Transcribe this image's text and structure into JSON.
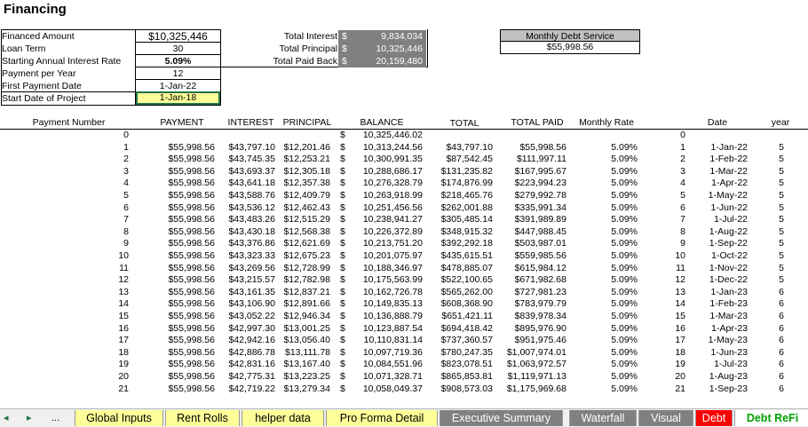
{
  "title": "Financing",
  "inputs": [
    {
      "label": "Financed Amount",
      "value": "$10,325,446"
    },
    {
      "label": "Loan Term",
      "value": "30"
    },
    {
      "label": "Starting Annual Interest Rate",
      "value": "5.09%"
    },
    {
      "label": "Payment per Year",
      "value": "12"
    },
    {
      "label": "First Payment Date",
      "value": "1-Jan-22"
    },
    {
      "label": "Start Date of Project",
      "value": "1-Jan-18"
    }
  ],
  "summary": [
    {
      "label": "Total Interest",
      "currency": "$",
      "value": "9,834,034"
    },
    {
      "label": "Total Principal",
      "currency": "$",
      "value": "10,325,446"
    },
    {
      "label": "Total Paid Back",
      "currency": "$",
      "value": "20,159,480"
    }
  ],
  "debt_service": {
    "label": "Monthly Debt Service",
    "value": "$55,998.56"
  },
  "columns": {
    "payment_number": "Payment Number",
    "payment": "PAYMENT",
    "interest": "INTEREST",
    "principal": "PRINCIPAL",
    "balance": "BALANCE",
    "total": "TOTAL",
    "total_paid": "TOTAL PAID",
    "monthly_rate": "Monthly Rate",
    "date": "Date",
    "year": "year"
  },
  "rows": [
    {
      "n": "0",
      "pay": "",
      "int": "",
      "prin": "",
      "cur": "$",
      "bal": "10,325,446.02",
      "tot": "",
      "paid": "",
      "rate": "",
      "idx": "0",
      "date": "",
      "yr": ""
    },
    {
      "n": "1",
      "pay": "$55,998.56",
      "int": "$43,797.10",
      "prin": "$12,201.46",
      "cur": "$",
      "bal": "10,313,244.56",
      "tot": "$43,797.10",
      "paid": "$55,998.56",
      "rate": "5.09%",
      "idx": "1",
      "date": "1-Jan-22",
      "yr": "5"
    },
    {
      "n": "2",
      "pay": "$55,998.56",
      "int": "$43,745.35",
      "prin": "$12,253.21",
      "cur": "$",
      "bal": "10,300,991.35",
      "tot": "$87,542.45",
      "paid": "$111,997.11",
      "rate": "5.09%",
      "idx": "2",
      "date": "1-Feb-22",
      "yr": "5"
    },
    {
      "n": "3",
      "pay": "$55,998.56",
      "int": "$43,693.37",
      "prin": "$12,305.18",
      "cur": "$",
      "bal": "10,288,686.17",
      "tot": "$131,235.82",
      "paid": "$167,995.67",
      "rate": "5.09%",
      "idx": "3",
      "date": "1-Mar-22",
      "yr": "5"
    },
    {
      "n": "4",
      "pay": "$55,998.56",
      "int": "$43,641.18",
      "prin": "$12,357.38",
      "cur": "$",
      "bal": "10,276,328.79",
      "tot": "$174,876.99",
      "paid": "$223,994.23",
      "rate": "5.09%",
      "idx": "4",
      "date": "1-Apr-22",
      "yr": "5"
    },
    {
      "n": "5",
      "pay": "$55,998.56",
      "int": "$43,588.76",
      "prin": "$12,409.79",
      "cur": "$",
      "bal": "10,263,918.99",
      "tot": "$218,465.76",
      "paid": "$279,992.78",
      "rate": "5.09%",
      "idx": "5",
      "date": "1-May-22",
      "yr": "5"
    },
    {
      "n": "6",
      "pay": "$55,998.56",
      "int": "$43,536.12",
      "prin": "$12,462.43",
      "cur": "$",
      "bal": "10,251,456.56",
      "tot": "$262,001.88",
      "paid": "$335,991.34",
      "rate": "5.09%",
      "idx": "6",
      "date": "1-Jun-22",
      "yr": "5"
    },
    {
      "n": "7",
      "pay": "$55,998.56",
      "int": "$43,483.26",
      "prin": "$12,515.29",
      "cur": "$",
      "bal": "10,238,941.27",
      "tot": "$305,485.14",
      "paid": "$391,989.89",
      "rate": "5.09%",
      "idx": "7",
      "date": "1-Jul-22",
      "yr": "5"
    },
    {
      "n": "8",
      "pay": "$55,998.56",
      "int": "$43,430.18",
      "prin": "$12,568.38",
      "cur": "$",
      "bal": "10,226,372.89",
      "tot": "$348,915.32",
      "paid": "$447,988.45",
      "rate": "5.09%",
      "idx": "8",
      "date": "1-Aug-22",
      "yr": "5"
    },
    {
      "n": "9",
      "pay": "$55,998.56",
      "int": "$43,376.86",
      "prin": "$12,621.69",
      "cur": "$",
      "bal": "10,213,751.20",
      "tot": "$392,292.18",
      "paid": "$503,987.01",
      "rate": "5.09%",
      "idx": "9",
      "date": "1-Sep-22",
      "yr": "5"
    },
    {
      "n": "10",
      "pay": "$55,998.56",
      "int": "$43,323.33",
      "prin": "$12,675.23",
      "cur": "$",
      "bal": "10,201,075.97",
      "tot": "$435,615.51",
      "paid": "$559,985.56",
      "rate": "5.09%",
      "idx": "10",
      "date": "1-Oct-22",
      "yr": "5"
    },
    {
      "n": "11",
      "pay": "$55,998.56",
      "int": "$43,269.56",
      "prin": "$12,728.99",
      "cur": "$",
      "bal": "10,188,346.97",
      "tot": "$478,885.07",
      "paid": "$615,984.12",
      "rate": "5.09%",
      "idx": "11",
      "date": "1-Nov-22",
      "yr": "5"
    },
    {
      "n": "12",
      "pay": "$55,998.56",
      "int": "$43,215.57",
      "prin": "$12,782.98",
      "cur": "$",
      "bal": "10,175,563.99",
      "tot": "$522,100.65",
      "paid": "$671,982.68",
      "rate": "5.09%",
      "idx": "12",
      "date": "1-Dec-22",
      "yr": "5"
    },
    {
      "n": "13",
      "pay": "$55,998.56",
      "int": "$43,161.35",
      "prin": "$12,837.21",
      "cur": "$",
      "bal": "10,162,726.78",
      "tot": "$565,262.00",
      "paid": "$727,981.23",
      "rate": "5.09%",
      "idx": "13",
      "date": "1-Jan-23",
      "yr": "6"
    },
    {
      "n": "14",
      "pay": "$55,998.56",
      "int": "$43,106.90",
      "prin": "$12,891.66",
      "cur": "$",
      "bal": "10,149,835.13",
      "tot": "$608,368.90",
      "paid": "$783,979.79",
      "rate": "5.09%",
      "idx": "14",
      "date": "1-Feb-23",
      "yr": "6"
    },
    {
      "n": "15",
      "pay": "$55,998.56",
      "int": "$43,052.22",
      "prin": "$12,946.34",
      "cur": "$",
      "bal": "10,136,888.79",
      "tot": "$651,421.11",
      "paid": "$839,978.34",
      "rate": "5.09%",
      "idx": "15",
      "date": "1-Mar-23",
      "yr": "6"
    },
    {
      "n": "16",
      "pay": "$55,998.56",
      "int": "$42,997.30",
      "prin": "$13,001.25",
      "cur": "$",
      "bal": "10,123,887.54",
      "tot": "$694,418.42",
      "paid": "$895,976.90",
      "rate": "5.09%",
      "idx": "16",
      "date": "1-Apr-23",
      "yr": "6"
    },
    {
      "n": "17",
      "pay": "$55,998.56",
      "int": "$42,942.16",
      "prin": "$13,056.40",
      "cur": "$",
      "bal": "10,110,831.14",
      "tot": "$737,360.57",
      "paid": "$951,975.46",
      "rate": "5.09%",
      "idx": "17",
      "date": "1-May-23",
      "yr": "6"
    },
    {
      "n": "18",
      "pay": "$55,998.56",
      "int": "$42,886.78",
      "prin": "$13,111.78",
      "cur": "$",
      "bal": "10,097,719.36",
      "tot": "$780,247.35",
      "paid": "$1,007,974.01",
      "rate": "5.09%",
      "idx": "18",
      "date": "1-Jun-23",
      "yr": "6"
    },
    {
      "n": "19",
      "pay": "$55,998.56",
      "int": "$42,831.16",
      "prin": "$13,167.40",
      "cur": "$",
      "bal": "10,084,551.96",
      "tot": "$823,078.51",
      "paid": "$1,063,972.57",
      "rate": "5.09%",
      "idx": "19",
      "date": "1-Jul-23",
      "yr": "6"
    },
    {
      "n": "20",
      "pay": "$55,998.56",
      "int": "$42,775.31",
      "prin": "$13,223.25",
      "cur": "$",
      "bal": "10,071,328.71",
      "tot": "$865,853.81",
      "paid": "$1,119,971.13",
      "rate": "5.09%",
      "idx": "20",
      "date": "1-Aug-23",
      "yr": "6"
    },
    {
      "n": "21",
      "pay": "$55,998.56",
      "int": "$42,719.22",
      "prin": "$13,279.34",
      "cur": "$",
      "bal": "10,058,049.37",
      "tot": "$908,573.03",
      "paid": "$1,175,969.68",
      "rate": "5.09%",
      "idx": "21",
      "date": "1-Sep-23",
      "yr": "6"
    }
  ],
  "sheet_tabs": [
    {
      "label": "Global Inputs",
      "color": "#ffff99",
      "text": "#000000"
    },
    {
      "label": "Rent Rolls",
      "color": "#ffff99",
      "text": "#000000"
    },
    {
      "label": "helper data",
      "color": "#ffff99",
      "text": "#000000"
    },
    {
      "label": "Pro Forma Detail",
      "color": "#ffff99",
      "text": "#000000"
    },
    {
      "label": "Executive Summary",
      "color": "#808080",
      "text": "#ffffff"
    },
    {
      "label": "Waterfall",
      "color": "#808080",
      "text": "#ffffff"
    },
    {
      "label": "Visual",
      "color": "#808080",
      "text": "#ffffff"
    },
    {
      "label": "Debt",
      "color": "#ff0000",
      "text": "#ffffff"
    },
    {
      "label": "Debt ReFi",
      "color": "#ffffff",
      "text": "#00a000"
    }
  ],
  "nav": {
    "prev_icon": "◂",
    "next_icon": "▸",
    "more": "..."
  },
  "colors": {
    "highlight_cell": "#ffff99",
    "summary_bg": "#808080",
    "active_cell_border": "#217346"
  }
}
